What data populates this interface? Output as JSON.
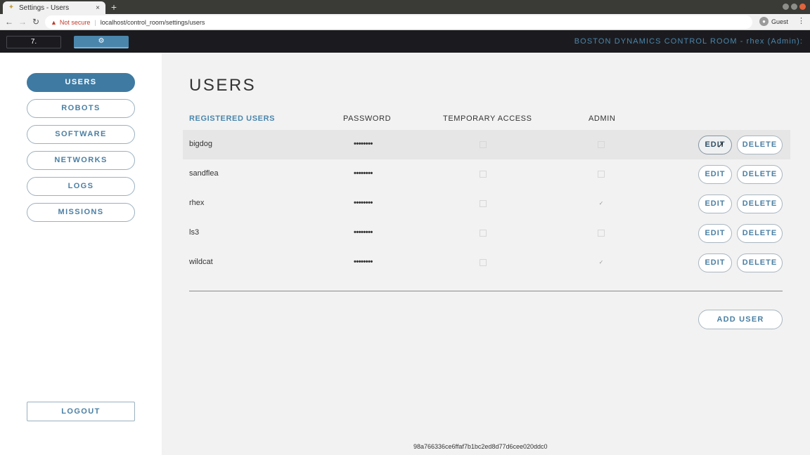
{
  "browser": {
    "tab_title": "Settings - Users",
    "tab_close": "×",
    "new_tab": "+",
    "not_secure": "Not secure",
    "url": "localhost/control_room/settings/users",
    "profile": "Guest",
    "back": "←",
    "forward": "→",
    "reload": "↻",
    "menu": "⋮"
  },
  "header": {
    "home_icon": "7.",
    "settings_icon": "⚙",
    "title": "BOSTON DYNAMICS CONTROL ROOM - rhex (Admin):"
  },
  "sidebar": {
    "items": [
      {
        "label": "USERS",
        "active": true
      },
      {
        "label": "ROBOTS",
        "active": false
      },
      {
        "label": "SOFTWARE",
        "active": false
      },
      {
        "label": "NETWORKS",
        "active": false
      },
      {
        "label": "LOGS",
        "active": false
      },
      {
        "label": "MISSIONS",
        "active": false
      }
    ],
    "logout": "LOGOUT"
  },
  "main": {
    "title": "USERS",
    "columns": {
      "users": "REGISTERED USERS",
      "password": "PASSWORD",
      "temp": "TEMPORARY ACCESS",
      "admin": "ADMIN"
    },
    "rows": [
      {
        "username": "bigdog",
        "password": "••••••••",
        "temporary_access": false,
        "admin": false
      },
      {
        "username": "sandflea",
        "password": "••••••••",
        "temporary_access": false,
        "admin": false
      },
      {
        "username": "rhex",
        "password": "••••••••",
        "temporary_access": false,
        "admin": true
      },
      {
        "username": "ls3",
        "password": "••••••••",
        "temporary_access": false,
        "admin": false
      },
      {
        "username": "wildcat",
        "password": "••••••••",
        "temporary_access": false,
        "admin": true
      }
    ],
    "edit_label": "EDIT",
    "delete_label": "DELETE",
    "add_user": "ADD USER",
    "build_hash": "98a766336ce6ffaf7b1bc2ed8d77d6cee020ddc0"
  },
  "colors": {
    "accent": "#4a86ac",
    "header_bg": "#1b1b1f",
    "active_nav": "#3f7aa2"
  },
  "icons": {
    "check": "✓",
    "warning": "▲"
  }
}
